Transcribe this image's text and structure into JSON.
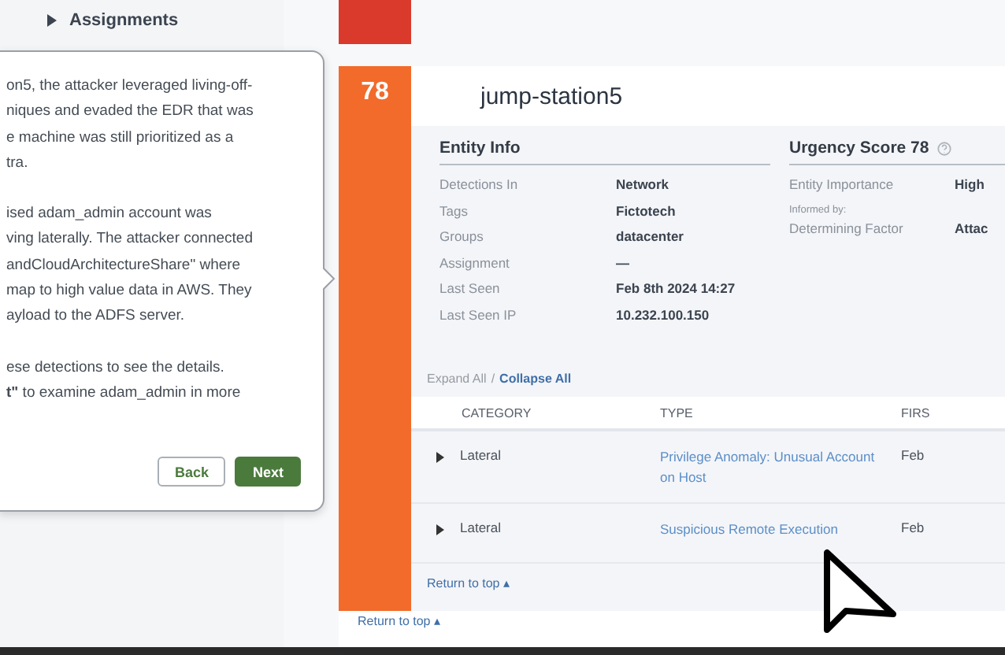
{
  "sidebar": {
    "items": [
      {
        "label": "Assignments",
        "expanded": false
      }
    ]
  },
  "popover": {
    "paragraphs": [
      "on5, the attacker leveraged living-off-\nniques and evaded the EDR that was\ne machine was still prioritized as a\ntra.",
      "ised adam_admin account was\nving laterally. The attacker connected\nandCloudArchitectureShare\" where\nmap to high value data in AWS. They\nayload to the ADFS server.",
      "ese detections to see the details.\n**t\"** to examine adam_admin in more"
    ],
    "buttons": [
      {
        "label": "Back",
        "kind": "secondary"
      },
      {
        "label": "Next",
        "kind": "primary"
      }
    ]
  },
  "previous_card": {
    "color": "#d93a2b"
  },
  "card": {
    "score": "78",
    "color": "#f26b2a",
    "title": "jump-station5",
    "entity_info": {
      "title": "Entity Info",
      "rows": [
        {
          "label": "Detections In",
          "value": "Network"
        },
        {
          "label": "Tags",
          "value": "Fictotech"
        },
        {
          "label": "Groups",
          "value": "datacenter"
        },
        {
          "label": "Assignment",
          "value": "—"
        },
        {
          "label": "Last Seen",
          "value": "Feb 8th 2024 14:27"
        },
        {
          "label": "Last Seen IP",
          "value": "10.232.100.150"
        }
      ]
    },
    "urgency": {
      "title": "Urgency Score 78",
      "rows": [
        {
          "label": "Entity Importance",
          "value": "High"
        },
        {
          "note": "Informed by:"
        },
        {
          "label": "Determining Factor",
          "value": "Attac"
        }
      ]
    },
    "expand_all": {
      "label": "Expand All",
      "disabled": true
    },
    "separator": "/",
    "collapse_all": {
      "label": "Collapse All",
      "disabled": false
    },
    "table": {
      "columns": [
        "CATEGORY",
        "TYPE",
        "FIRS"
      ],
      "rows": [
        {
          "expanded": false,
          "category": "Lateral",
          "type": "Privilege Anomaly: Unusual Account on Host",
          "first": "Feb"
        },
        {
          "expanded": false,
          "category": "Lateral",
          "type": "Suspicious Remote Execution",
          "first": "Feb"
        }
      ]
    },
    "return_to_top": "Return to top",
    "return_icon": "▴"
  },
  "return_to_top": "Return to top",
  "return_icon": "▴"
}
